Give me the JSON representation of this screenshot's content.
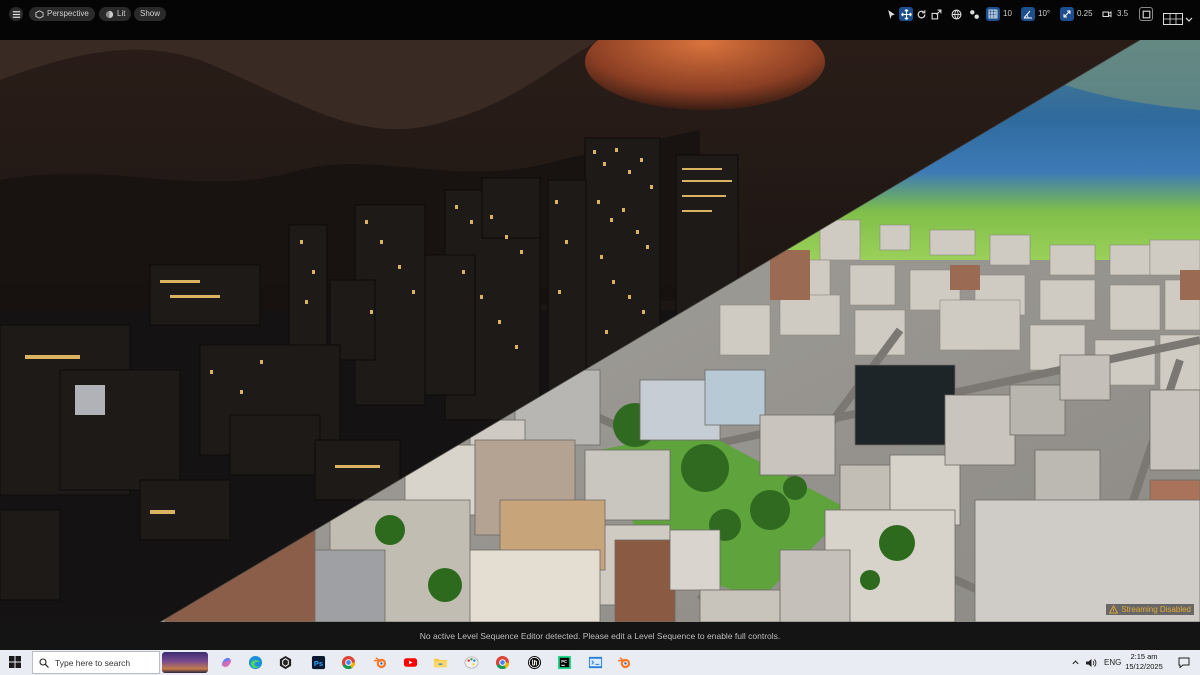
{
  "toolbar": {
    "menu_icon": "hamburger-icon",
    "perspective_label": "Perspective",
    "lit_label": "Lit",
    "show_label": "Show",
    "grid_snap_value": "10",
    "rotation_snap_value": "10°",
    "scale_snap_value": "0.25",
    "camera_speed_value": "3.5"
  },
  "viewport": {
    "streaming_status": "Streaming Disabled"
  },
  "sequencer": {
    "message": "No active Level Sequence Editor detected. Please edit a Level Sequence to enable full controls."
  },
  "taskbar": {
    "search_placeholder": "Type here to search",
    "apps": [
      "copilot",
      "edge",
      "unity",
      "photoshop",
      "chrome",
      "blender",
      "youtube",
      "file-explorer",
      "paint",
      "chrome",
      "unreal-engine",
      "pycharm",
      "vscode",
      "blender"
    ],
    "language": "ENG",
    "time": "2:15 am",
    "date": "15/12/2025"
  },
  "colors": {
    "accent_blue": "#1d4f8f",
    "warning": "#e2a93b",
    "taskbar_bg": "#e9edf3"
  }
}
